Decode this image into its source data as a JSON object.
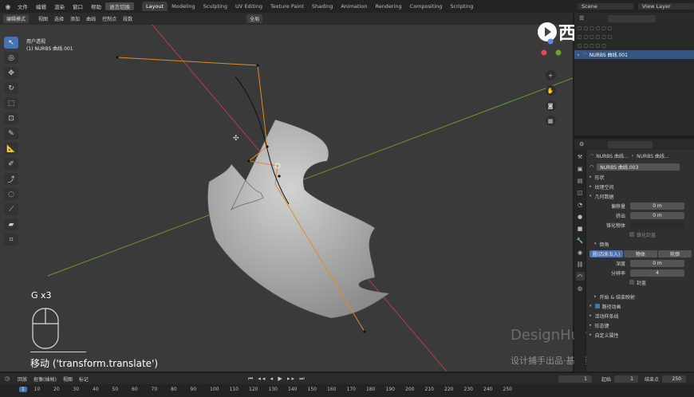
{
  "topbar": {
    "menus": [
      "文件",
      "编辑",
      "渲染",
      "窗口",
      "帮助"
    ],
    "mode_label": "语言切换",
    "workspaces": [
      "Layout",
      "Modeling",
      "Sculpting",
      "UV Editing",
      "Texture Paint",
      "Shading",
      "Animation",
      "Rendering",
      "Compositing",
      "Scripting"
    ],
    "scene": "Scene",
    "view_layer": "View Layer"
  },
  "viewport_header": {
    "mode": "编辑模式",
    "menus": [
      "视图",
      "选择",
      "添加",
      "曲线",
      "控制点",
      "段数"
    ],
    "orientation": "全局"
  },
  "viewport_info": {
    "line1": "用户透视",
    "line2": "(1) NURBS 曲线.001"
  },
  "operator": {
    "key_text": "G x3",
    "label": "移动 ('transform.translate')"
  },
  "watermark": {
    "logo": "西瓜视频",
    "line1": "DesignHunting",
    "line2": "设计捕手出品·基础部分"
  },
  "outliner": {
    "row": "NURBS 曲线.001"
  },
  "properties": {
    "object_name": "NURBS 曲线...",
    "data_name": "NURBS 曲线...",
    "datablock": "NURBS 曲线.003",
    "sections": {
      "shape": "形状",
      "texture_space": "纹理空间",
      "geometry": "几何数据",
      "bevel": "倒角",
      "start_end": "开始 & 结束映射",
      "path_anim": "路径动画",
      "active_spline": "活动样条线",
      "shape_keys": "形态键",
      "custom_props": "自定义属性"
    },
    "offset_label": "偏移量",
    "offset_value": "0 m",
    "extrude_label": "挤出",
    "extrude_value": "0 m",
    "taper_label": "锥化物体",
    "taper_check": "锥化封盖",
    "bevel_modes": [
      "圆(四舍五入)",
      "物体",
      "轮廓"
    ],
    "depth_label": "深度",
    "depth_value": "0 m",
    "resolution_label": "分辨率",
    "resolution_value": "4",
    "fill_caps": "封盖"
  },
  "timeline": {
    "menus": [
      "回放",
      "抠像(插帧)",
      "视图",
      "标记"
    ],
    "current_frame": "1",
    "start_label": "起始",
    "start_value": "1",
    "end_label": "结束点",
    "end_value": "250"
  },
  "ruler": [
    "1",
    "10",
    "20",
    "30",
    "40",
    "50",
    "60",
    "70",
    "80",
    "90",
    "100",
    "110",
    "120",
    "130",
    "140",
    "150",
    "160",
    "170",
    "180",
    "190",
    "200",
    "210",
    "220",
    "230",
    "240",
    "250"
  ]
}
